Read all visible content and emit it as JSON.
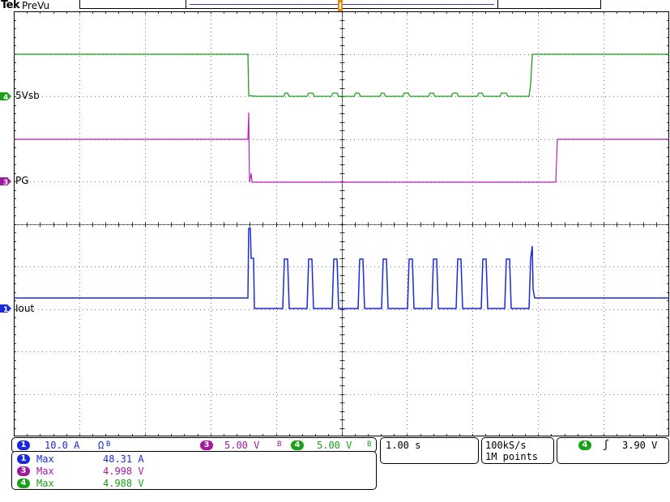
{
  "header": {
    "brand": "Tek",
    "mode": "PreVu"
  },
  "colors": {
    "ch1": "#1a2ad8",
    "ch3": "#a01aa0",
    "ch4": "#1aa01a",
    "trigger_marker": "#f08a00"
  },
  "channels": {
    "ch4_label": "5Vsb",
    "ch3_label": "PG",
    "ch1_label": "Iout",
    "ch4_num": "4",
    "ch3_num": "3",
    "ch1_num": "1"
  },
  "scale_bar": {
    "ch1_num": "1",
    "ch1_scale": "10.0 A",
    "ch1_suffix": "Ω",
    "ch1_bw": "B",
    "ch3_num": "3",
    "ch3_scale": "5.00 V",
    "ch3_bw": "B",
    "ch4_num": "4",
    "ch4_scale": "5.00 V",
    "ch4_bw": "B",
    "timebase": "1.00 s",
    "sample_rate": "100kS/s",
    "record_length": "1M points",
    "trigger_channel": "4",
    "trigger_slope": "ʃ",
    "trigger_level": "3.90 V"
  },
  "measurements": [
    {
      "num": "1",
      "label": "Max",
      "value": "48.31 A"
    },
    {
      "num": "3",
      "label": "Max",
      "value": "4.998 V"
    },
    {
      "num": "4",
      "label": "Max",
      "value": "4.988 V"
    }
  ]
}
